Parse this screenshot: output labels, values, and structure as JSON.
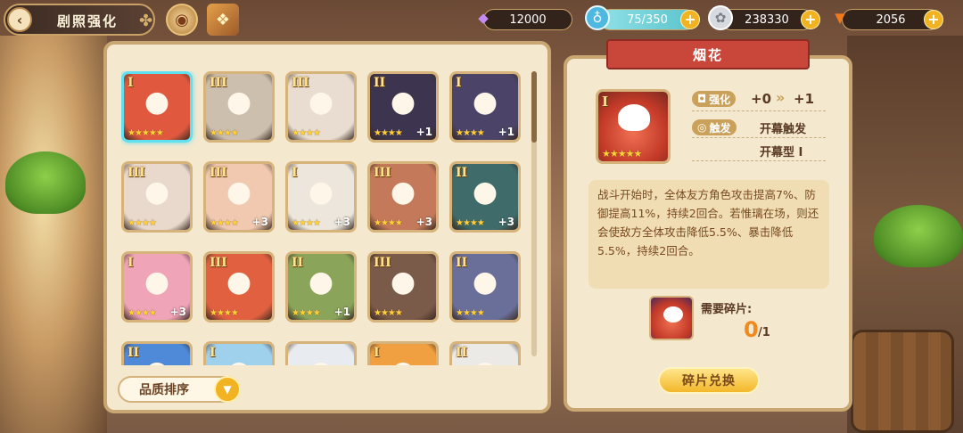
{
  "header": {
    "title": "剧照强化",
    "back_icon": "back-arrow-icon",
    "clover_icon": "clover-icon",
    "icon_buttons": [
      "rune-circle-icon",
      "spellbook-icon"
    ]
  },
  "resources": [
    {
      "name": "crystal",
      "icon": "crystal-icon",
      "value": "12000",
      "has_plus": false
    },
    {
      "name": "stamina",
      "icon": "potion-icon",
      "value": "75/350",
      "has_plus": true
    },
    {
      "name": "silver",
      "icon": "silver-coin-icon",
      "value": "238330",
      "has_plus": true
    },
    {
      "name": "carrot",
      "icon": "carrot-icon",
      "value": "2056",
      "has_plus": true
    }
  ],
  "cards": [
    {
      "rank": "I",
      "stars": "★★★★★",
      "plus": "",
      "selected": true,
      "color": "#e0593e"
    },
    {
      "rank": "III",
      "stars": "★★★★",
      "plus": "",
      "selected": false,
      "color": "#cdbfae"
    },
    {
      "rank": "III",
      "stars": "★★★★",
      "plus": "",
      "selected": false,
      "color": "#e8ddd0"
    },
    {
      "rank": "II",
      "stars": "★★★★",
      "plus": "+1",
      "selected": false,
      "color": "#3d3550"
    },
    {
      "rank": "I",
      "stars": "★★★★",
      "plus": "+1",
      "selected": false,
      "color": "#4b4468"
    },
    {
      "rank": "III",
      "stars": "★★★★",
      "plus": "",
      "selected": false,
      "color": "#e9d8cc"
    },
    {
      "rank": "III",
      "stars": "★★★★",
      "plus": "+3",
      "selected": false,
      "color": "#f0c9b0"
    },
    {
      "rank": "I",
      "stars": "★★★★",
      "plus": "+3",
      "selected": false,
      "color": "#ece6dc"
    },
    {
      "rank": "III",
      "stars": "★★★★",
      "plus": "+3",
      "selected": false,
      "color": "#c47a5a"
    },
    {
      "rank": "II",
      "stars": "★★★★",
      "plus": "+3",
      "selected": false,
      "color": "#3f6b6a"
    },
    {
      "rank": "I",
      "stars": "★★★★",
      "plus": "+3",
      "selected": false,
      "color": "#f0a4b8"
    },
    {
      "rank": "III",
      "stars": "★★★★",
      "plus": "",
      "selected": false,
      "color": "#e06040"
    },
    {
      "rank": "II",
      "stars": "★★★★",
      "plus": "+1",
      "selected": false,
      "color": "#8aa55a"
    },
    {
      "rank": "III",
      "stars": "★★★★",
      "plus": "",
      "selected": false,
      "color": "#7a5a48"
    },
    {
      "rank": "II",
      "stars": "★★★★",
      "plus": "",
      "selected": false,
      "color": "#6a6f9a"
    },
    {
      "rank": "II",
      "stars": "",
      "plus": "",
      "selected": false,
      "color": "#4f8ad8"
    },
    {
      "rank": "I",
      "stars": "",
      "plus": "",
      "selected": false,
      "color": "#9fd0ec"
    },
    {
      "rank": "",
      "stars": "",
      "plus": "",
      "selected": false,
      "color": "#e8ecf0"
    },
    {
      "rank": "I",
      "stars": "",
      "plus": "",
      "selected": false,
      "color": "#f0a040"
    },
    {
      "rank": "II",
      "stars": "",
      "plus": "",
      "selected": false,
      "color": "#eceae6"
    }
  ],
  "sort": {
    "label": "品质排序",
    "arrow_icon": "chevron-down-icon"
  },
  "detail": {
    "name": "烟花",
    "rank": "I",
    "stars": "★★★★★",
    "enhance_label": "强化",
    "enhance_from": "+0",
    "enhance_arrow": "»",
    "enhance_to": "+1",
    "trigger_label": "触发",
    "trigger_value": "开幕触发",
    "type_value": "开幕型 I",
    "description": "战斗开始时，全体友方角色攻击提高7%、防御提高11%，持续2回合。若惟璃在场，则还会使敌方全体攻击降低5.5%、暴击降低5.5%，持续2回合。",
    "fragment_label": "需要碎片:",
    "fragment_count": "0",
    "fragment_total": "/1",
    "exchange_button": "碎片兑换"
  }
}
